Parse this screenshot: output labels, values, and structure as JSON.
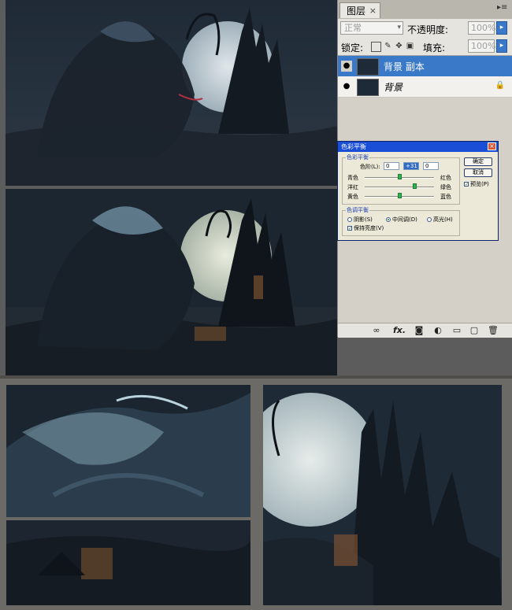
{
  "layers_panel": {
    "tab_label": "图层",
    "tab_close": "×",
    "menu_glyph": "▸≡",
    "blend_mode": "正常",
    "opacity_label": "不透明度:",
    "opacity_value": "100%",
    "lock_label": "锁定:",
    "fill_label": "填充:",
    "fill_value": "100%",
    "layers": [
      {
        "name": "背景 副本",
        "selected": true
      },
      {
        "name": "背景",
        "selected": false,
        "locked": true
      }
    ],
    "bottom_icons": [
      "link-icon",
      "fx-icon",
      "mask-icon",
      "adjustment-icon",
      "folder-icon",
      "new-layer-icon",
      "trash-icon"
    ],
    "fx_text": "fx."
  },
  "color_balance_dialog": {
    "title": "色彩平衡",
    "close": "×",
    "group_balance": "色彩平衡",
    "levels_label": "色阶(L):",
    "levels": [
      "0",
      "+31",
      "0"
    ],
    "sliders": [
      {
        "left": "青色",
        "right": "红色",
        "position": 0.5
      },
      {
        "left": "洋红",
        "right": "绿色",
        "position": 0.72
      },
      {
        "left": "黄色",
        "right": "蓝色",
        "position": 0.5
      }
    ],
    "group_tone": "色调平衡",
    "tones": [
      {
        "label": "阴影(S)",
        "selected": false
      },
      {
        "label": "中间调(D)",
        "selected": true
      },
      {
        "label": "高光(H)",
        "selected": false
      }
    ],
    "preserve_luminosity": "保持亮度(V)",
    "ok_label": "确定",
    "cancel_label": "取消",
    "preview_label": "预览(P)",
    "preserve_checked": true,
    "preview_checked": true
  },
  "colors": {
    "selection_blue": "#3a78c8",
    "dialog_title_blue": "#1a4ed6",
    "slider_green": "#2cb24e"
  }
}
